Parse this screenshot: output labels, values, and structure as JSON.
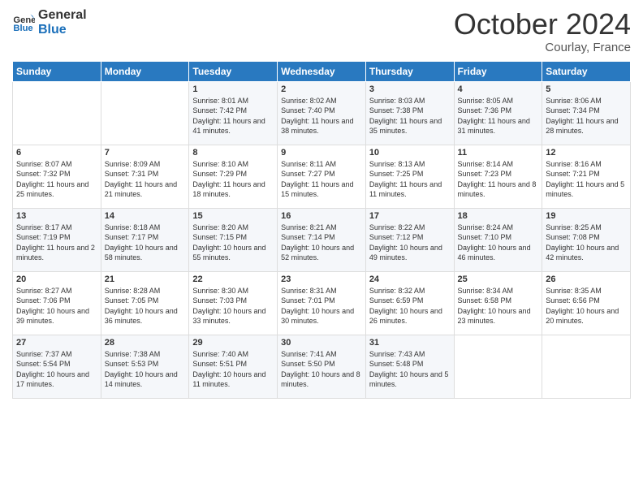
{
  "logo": {
    "text_general": "General",
    "text_blue": "Blue"
  },
  "header": {
    "month": "October 2024",
    "location": "Courlay, France"
  },
  "weekdays": [
    "Sunday",
    "Monday",
    "Tuesday",
    "Wednesday",
    "Thursday",
    "Friday",
    "Saturday"
  ],
  "weeks": [
    [
      {
        "day": "",
        "info": ""
      },
      {
        "day": "",
        "info": ""
      },
      {
        "day": "1",
        "info": "Sunrise: 8:01 AM\nSunset: 7:42 PM\nDaylight: 11 hours and 41 minutes."
      },
      {
        "day": "2",
        "info": "Sunrise: 8:02 AM\nSunset: 7:40 PM\nDaylight: 11 hours and 38 minutes."
      },
      {
        "day": "3",
        "info": "Sunrise: 8:03 AM\nSunset: 7:38 PM\nDaylight: 11 hours and 35 minutes."
      },
      {
        "day": "4",
        "info": "Sunrise: 8:05 AM\nSunset: 7:36 PM\nDaylight: 11 hours and 31 minutes."
      },
      {
        "day": "5",
        "info": "Sunrise: 8:06 AM\nSunset: 7:34 PM\nDaylight: 11 hours and 28 minutes."
      }
    ],
    [
      {
        "day": "6",
        "info": "Sunrise: 8:07 AM\nSunset: 7:32 PM\nDaylight: 11 hours and 25 minutes."
      },
      {
        "day": "7",
        "info": "Sunrise: 8:09 AM\nSunset: 7:31 PM\nDaylight: 11 hours and 21 minutes."
      },
      {
        "day": "8",
        "info": "Sunrise: 8:10 AM\nSunset: 7:29 PM\nDaylight: 11 hours and 18 minutes."
      },
      {
        "day": "9",
        "info": "Sunrise: 8:11 AM\nSunset: 7:27 PM\nDaylight: 11 hours and 15 minutes."
      },
      {
        "day": "10",
        "info": "Sunrise: 8:13 AM\nSunset: 7:25 PM\nDaylight: 11 hours and 11 minutes."
      },
      {
        "day": "11",
        "info": "Sunrise: 8:14 AM\nSunset: 7:23 PM\nDaylight: 11 hours and 8 minutes."
      },
      {
        "day": "12",
        "info": "Sunrise: 8:16 AM\nSunset: 7:21 PM\nDaylight: 11 hours and 5 minutes."
      }
    ],
    [
      {
        "day": "13",
        "info": "Sunrise: 8:17 AM\nSunset: 7:19 PM\nDaylight: 11 hours and 2 minutes."
      },
      {
        "day": "14",
        "info": "Sunrise: 8:18 AM\nSunset: 7:17 PM\nDaylight: 10 hours and 58 minutes."
      },
      {
        "day": "15",
        "info": "Sunrise: 8:20 AM\nSunset: 7:15 PM\nDaylight: 10 hours and 55 minutes."
      },
      {
        "day": "16",
        "info": "Sunrise: 8:21 AM\nSunset: 7:14 PM\nDaylight: 10 hours and 52 minutes."
      },
      {
        "day": "17",
        "info": "Sunrise: 8:22 AM\nSunset: 7:12 PM\nDaylight: 10 hours and 49 minutes."
      },
      {
        "day": "18",
        "info": "Sunrise: 8:24 AM\nSunset: 7:10 PM\nDaylight: 10 hours and 46 minutes."
      },
      {
        "day": "19",
        "info": "Sunrise: 8:25 AM\nSunset: 7:08 PM\nDaylight: 10 hours and 42 minutes."
      }
    ],
    [
      {
        "day": "20",
        "info": "Sunrise: 8:27 AM\nSunset: 7:06 PM\nDaylight: 10 hours and 39 minutes."
      },
      {
        "day": "21",
        "info": "Sunrise: 8:28 AM\nSunset: 7:05 PM\nDaylight: 10 hours and 36 minutes."
      },
      {
        "day": "22",
        "info": "Sunrise: 8:30 AM\nSunset: 7:03 PM\nDaylight: 10 hours and 33 minutes."
      },
      {
        "day": "23",
        "info": "Sunrise: 8:31 AM\nSunset: 7:01 PM\nDaylight: 10 hours and 30 minutes."
      },
      {
        "day": "24",
        "info": "Sunrise: 8:32 AM\nSunset: 6:59 PM\nDaylight: 10 hours and 26 minutes."
      },
      {
        "day": "25",
        "info": "Sunrise: 8:34 AM\nSunset: 6:58 PM\nDaylight: 10 hours and 23 minutes."
      },
      {
        "day": "26",
        "info": "Sunrise: 8:35 AM\nSunset: 6:56 PM\nDaylight: 10 hours and 20 minutes."
      }
    ],
    [
      {
        "day": "27",
        "info": "Sunrise: 7:37 AM\nSunset: 5:54 PM\nDaylight: 10 hours and 17 minutes."
      },
      {
        "day": "28",
        "info": "Sunrise: 7:38 AM\nSunset: 5:53 PM\nDaylight: 10 hours and 14 minutes."
      },
      {
        "day": "29",
        "info": "Sunrise: 7:40 AM\nSunset: 5:51 PM\nDaylight: 10 hours and 11 minutes."
      },
      {
        "day": "30",
        "info": "Sunrise: 7:41 AM\nSunset: 5:50 PM\nDaylight: 10 hours and 8 minutes."
      },
      {
        "day": "31",
        "info": "Sunrise: 7:43 AM\nSunset: 5:48 PM\nDaylight: 10 hours and 5 minutes."
      },
      {
        "day": "",
        "info": ""
      },
      {
        "day": "",
        "info": ""
      }
    ]
  ]
}
